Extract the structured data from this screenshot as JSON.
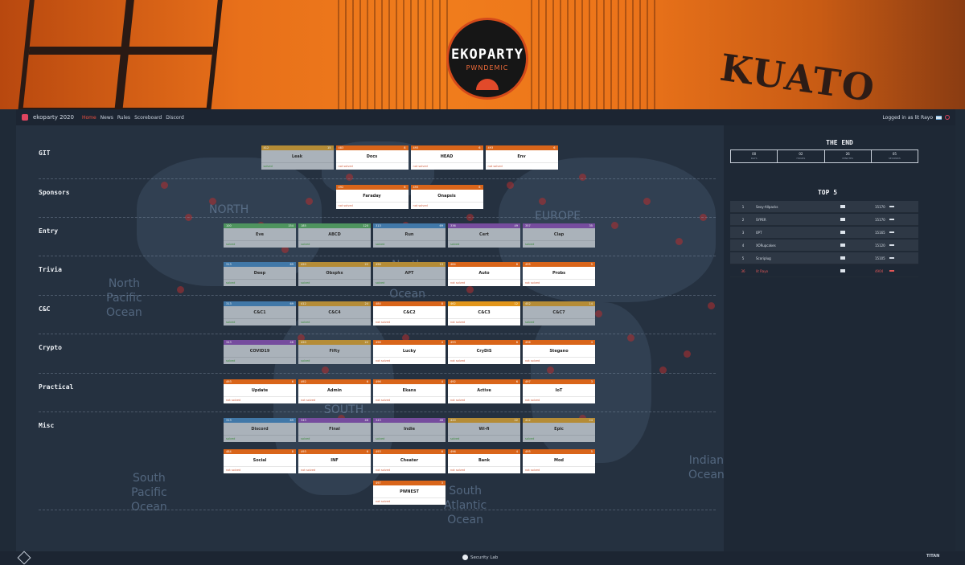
{
  "banner": {
    "logo_title": "EKOPARTY",
    "logo_subtitle": "PWNDEMIC",
    "graffiti": "KUATO"
  },
  "nav": {
    "brand": "ekoparty 2020",
    "links": [
      "Home",
      "News",
      "Rules",
      "Scoreboard",
      "Discord"
    ],
    "active_link": "Home",
    "logged_in_text": "Logged in as lit Rayo"
  },
  "map_labels": {
    "north_america": "NORTH",
    "europe": "EUROPE",
    "north_pacific": "North\nPacific\nOcean",
    "north_atlantic": "North\nAtlantic\nOcean",
    "south_america": "SOUTH",
    "south_pacific": "South\nPacific\nOcean",
    "south_atlantic": "South\nAtlantic\nOcean",
    "indian": "Indian\nOcean"
  },
  "colors": {
    "orange": "#d9651a",
    "green": "#3e8f4e",
    "blue": "#2f6fa6",
    "purple": "#6d3b9a",
    "gold": "#b8861f",
    "amber": "#e2961a",
    "solved_bg": "#aab2ba"
  },
  "categories": [
    {
      "name": "GIT",
      "rows": [
        [
          {
            "title": "Leak",
            "points": "412",
            "solvers": "15",
            "status": "solved",
            "status_text": "solved",
            "color": "gold"
          },
          {
            "title": "Docs",
            "points": "483",
            "solvers": "8",
            "status": "open",
            "status_text": "not solved",
            "color": "orange"
          },
          {
            "title": "HEAD",
            "points": "493",
            "solvers": "6",
            "status": "open",
            "status_text": "not solved",
            "color": "orange"
          },
          {
            "title": "Env",
            "points": "493",
            "solvers": "6",
            "status": "open",
            "status_text": "not solved",
            "color": "orange"
          }
        ]
      ]
    },
    {
      "name": "Sponsors",
      "rows": [
        [
          {
            "title": "Faraday",
            "points": "492",
            "solvers": "6",
            "status": "open",
            "status_text": "not solved",
            "color": "orange"
          },
          {
            "title": "Onapsis",
            "points": "493",
            "solvers": "6",
            "status": "open",
            "status_text": "not solved",
            "color": "orange"
          }
        ]
      ]
    },
    {
      "name": "Entry",
      "rows": [
        [
          {
            "title": "Eve",
            "points": "100",
            "solvers": "154",
            "status": "solved",
            "status_text": "solved",
            "color": "green"
          },
          {
            "title": "ABCD",
            "points": "185",
            "solvers": "120",
            "status": "solved",
            "status_text": "solved",
            "color": "green"
          },
          {
            "title": "Run",
            "points": "313",
            "solvers": "69",
            "status": "solved",
            "status_text": "solved",
            "color": "blue"
          },
          {
            "title": "Cert",
            "points": "336",
            "solvers": "49",
            "status": "solved",
            "status_text": "solved",
            "color": "purple"
          },
          {
            "title": "Clap",
            "points": "357",
            "solvers": "35",
            "status": "solved",
            "status_text": "solved",
            "color": "purple"
          }
        ]
      ]
    },
    {
      "name": "Trivia",
      "rows": [
        [
          {
            "title": "Deep",
            "points": "313",
            "solvers": "69",
            "status": "solved",
            "status_text": "solved",
            "color": "blue"
          },
          {
            "title": "Obsphx",
            "points": "420",
            "solvers": "22",
            "status": "solved",
            "status_text": "solved",
            "color": "gold"
          },
          {
            "title": "APT",
            "points": "456",
            "solvers": "13",
            "status": "solved",
            "status_text": "solved",
            "color": "gold"
          },
          {
            "title": "Auto",
            "points": "484",
            "solvers": "8",
            "status": "open",
            "status_text": "not solved",
            "color": "orange"
          },
          {
            "title": "Probs",
            "points": "495",
            "solvers": "5",
            "status": "open",
            "status_text": "not solved",
            "color": "orange"
          }
        ]
      ]
    },
    {
      "name": "C&C",
      "rows": [
        [
          {
            "title": "C&C1",
            "points": "313",
            "solvers": "69",
            "status": "solved",
            "status_text": "solved",
            "color": "blue"
          },
          {
            "title": "C&C4",
            "points": "412",
            "solvers": "24",
            "status": "solved",
            "status_text": "solved",
            "color": "gold"
          },
          {
            "title": "C&C2",
            "points": "484",
            "solvers": "8",
            "status": "open",
            "status_text": "not solved",
            "color": "orange"
          },
          {
            "title": "C&C3",
            "points": "462",
            "solvers": "12",
            "status": "open",
            "status_text": "not solved",
            "color": "amber"
          },
          {
            "title": "C&C7",
            "points": "452",
            "solvers": "14",
            "status": "solved",
            "status_text": "solved",
            "color": "gold"
          }
        ]
      ]
    },
    {
      "name": "Crypto",
      "rows": [
        [
          {
            "title": "COVID19",
            "points": "343",
            "solvers": "46",
            "status": "solved",
            "status_text": "solved",
            "color": "purple"
          },
          {
            "title": "Fifty",
            "points": "420",
            "solvers": "22",
            "status": "solved",
            "status_text": "solved",
            "color": "gold"
          },
          {
            "title": "Lucky",
            "points": "496",
            "solvers": "4",
            "status": "open",
            "status_text": "not solved",
            "color": "orange"
          },
          {
            "title": "CryDiS",
            "points": "493",
            "solvers": "6",
            "status": "open",
            "status_text": "not solved",
            "color": "orange"
          },
          {
            "title": "Stegano",
            "points": "496",
            "solvers": "4",
            "status": "open",
            "status_text": "not solved",
            "color": "orange"
          }
        ]
      ]
    },
    {
      "name": "Practical",
      "rows": [
        [
          {
            "title": "Update",
            "points": "493",
            "solvers": "6",
            "status": "open",
            "status_text": "not solved",
            "color": "orange"
          },
          {
            "title": "Admin",
            "points": "492",
            "solvers": "6",
            "status": "open",
            "status_text": "not solved",
            "color": "orange"
          },
          {
            "title": "Ekans",
            "points": "496",
            "solvers": "4",
            "status": "open",
            "status_text": "not solved",
            "color": "orange"
          },
          {
            "title": "Active",
            "points": "492",
            "solvers": "6",
            "status": "open",
            "status_text": "not solved",
            "color": "orange"
          },
          {
            "title": "IoT",
            "points": "497",
            "solvers": "3",
            "status": "open",
            "status_text": "not solved",
            "color": "orange"
          }
        ]
      ]
    },
    {
      "name": "Misc",
      "rows": [
        [
          {
            "title": "Discord",
            "points": "313",
            "solvers": "69",
            "status": "solved",
            "status_text": "solved",
            "color": "blue"
          },
          {
            "title": "Final",
            "points": "343",
            "solvers": "46",
            "status": "solved",
            "status_text": "solved",
            "color": "purple"
          },
          {
            "title": "Indie",
            "points": "343",
            "solvers": "46",
            "status": "solved",
            "status_text": "solved",
            "color": "purple"
          },
          {
            "title": "Wi-fi",
            "points": "420",
            "solvers": "22",
            "status": "solved",
            "status_text": "solved",
            "color": "gold"
          },
          {
            "title": "Epic",
            "points": "412",
            "solvers": "24",
            "status": "solved",
            "status_text": "solved",
            "color": "gold"
          }
        ],
        [
          {
            "title": "Social",
            "points": "484",
            "solvers": "8",
            "status": "open",
            "status_text": "not solved",
            "color": "orange"
          },
          {
            "title": "INF",
            "points": "493",
            "solvers": "6",
            "status": "open",
            "status_text": "not solved",
            "color": "orange"
          },
          {
            "title": "Cheater",
            "points": "493",
            "solvers": "6",
            "status": "open",
            "status_text": "not solved",
            "color": "orange"
          },
          {
            "title": "Bank",
            "points": "496",
            "solvers": "4",
            "status": "open",
            "status_text": "not solved",
            "color": "orange"
          },
          {
            "title": "Mod",
            "points": "495",
            "solvers": "5",
            "status": "open",
            "status_text": "not solved",
            "color": "orange"
          }
        ],
        [
          {
            "title": "PWNEST",
            "points": "497",
            "solvers": "3",
            "status": "open",
            "status_text": "not solved",
            "color": "orange"
          }
        ]
      ]
    }
  ],
  "sidebar": {
    "end_title": "THE END",
    "timer": [
      {
        "value": "00",
        "unit": "DAYS"
      },
      {
        "value": "02",
        "unit": "HOURS"
      },
      {
        "value": "26",
        "unit": "MINUTES"
      },
      {
        "value": "05",
        "unit": "SECONDS"
      }
    ],
    "top5_title": "TOP 5",
    "top5": [
      {
        "pos": "1",
        "name": "Sexy-Allpacks",
        "points": "15170"
      },
      {
        "pos": "2",
        "name": "SYPER",
        "points": "15170"
      },
      {
        "pos": "3",
        "name": "0PT",
        "points": "15165"
      },
      {
        "pos": "4",
        "name": "XORupcakes",
        "points": "15120"
      },
      {
        "pos": "5",
        "name": "Scoriplug",
        "points": "15105"
      }
    ],
    "me": {
      "pos": "36",
      "name": "lit Rayo",
      "points": "4904"
    }
  },
  "footer": {
    "center_text": "Security Lab",
    "right_text": "TITAN"
  }
}
